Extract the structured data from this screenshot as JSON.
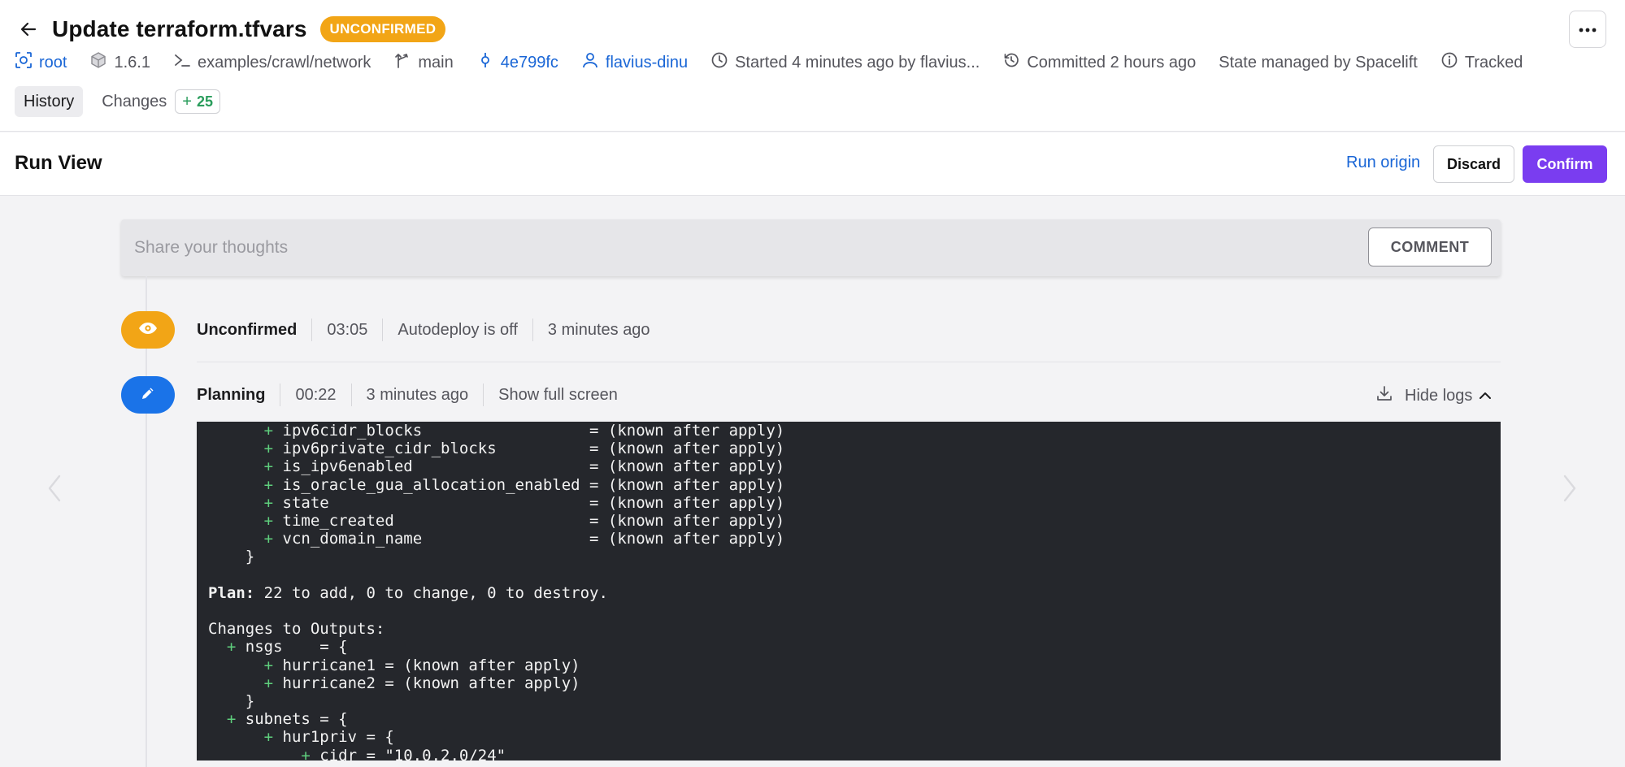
{
  "header": {
    "title": "Update terraform.tfvars",
    "status_badge": "UNCONFIRMED",
    "meta": {
      "space": "root",
      "version": "1.6.1",
      "project_root": "examples/crawl/network",
      "branch": "main",
      "commit": "4e799fc",
      "author": "flavius-dinu",
      "started": "Started 4 minutes ago by flavius...",
      "committed": "Committed 2 hours ago",
      "state": "State managed by Spacelift",
      "tracked": "Tracked"
    },
    "tabs": [
      {
        "label": "History",
        "active": true
      },
      {
        "label": "Changes",
        "count": "25"
      }
    ]
  },
  "run_view": {
    "title": "Run View",
    "run_origin": "Run origin",
    "discard": "Discard",
    "confirm": "Confirm"
  },
  "comment": {
    "placeholder": "Share your thoughts",
    "button": "COMMENT"
  },
  "stages": [
    {
      "name": "Unconfirmed",
      "duration": "03:05",
      "info": "Autodeploy is off",
      "time": "3 minutes ago"
    },
    {
      "name": "Planning",
      "duration": "00:22",
      "time": "3 minutes ago",
      "full_screen": "Show full screen",
      "hide_logs": "Hide logs"
    }
  ],
  "log": {
    "lines": [
      {
        "indent": "      ",
        "plus": true,
        "text": "ipv6cidr_blocks                  = (known after apply)"
      },
      {
        "indent": "      ",
        "plus": true,
        "text": "ipv6private_cidr_blocks          = (known after apply)"
      },
      {
        "indent": "      ",
        "plus": true,
        "text": "is_ipv6enabled                   = (known after apply)"
      },
      {
        "indent": "      ",
        "plus": true,
        "text": "is_oracle_gua_allocation_enabled = (known after apply)"
      },
      {
        "indent": "      ",
        "plus": true,
        "text": "state                            = (known after apply)"
      },
      {
        "indent": "      ",
        "plus": true,
        "text": "time_created                     = (known after apply)"
      },
      {
        "indent": "      ",
        "plus": true,
        "text": "vcn_domain_name                  = (known after apply)"
      },
      {
        "indent": "    ",
        "plus": false,
        "text": "}"
      },
      {
        "indent": "",
        "plus": false,
        "text": ""
      },
      {
        "indent": "",
        "plus": false,
        "bold": "Plan:",
        "text": " 22 to add, 0 to change, 0 to destroy."
      },
      {
        "indent": "",
        "plus": false,
        "text": ""
      },
      {
        "indent": "",
        "plus": false,
        "text": "Changes to Outputs:"
      },
      {
        "indent": "  ",
        "plus": true,
        "text": "nsgs    = {"
      },
      {
        "indent": "      ",
        "plus": true,
        "text": "hurricane1 = (known after apply)"
      },
      {
        "indent": "      ",
        "plus": true,
        "text": "hurricane2 = (known after apply)"
      },
      {
        "indent": "    ",
        "plus": false,
        "text": "}"
      },
      {
        "indent": "  ",
        "plus": true,
        "text": "subnets = {"
      },
      {
        "indent": "      ",
        "plus": true,
        "text": "hur1priv = {"
      },
      {
        "indent": "          ",
        "plus": true,
        "text": "cidr = \"10.0.2.0/24\""
      }
    ]
  },
  "colors": {
    "accent_purple": "#7a3df0",
    "link_blue": "#1a66d6",
    "badge_orange": "#f2a516",
    "planning_blue": "#1a73e8",
    "log_bg": "#25272c",
    "plus_green": "#5fcf7d"
  },
  "icons": {
    "back": "arrow-left-icon",
    "more": "more-horizontal-icon",
    "space": "space-icon",
    "version": "cube-icon",
    "project_root": "terminal-icon",
    "branch": "branch-icon",
    "commit": "commit-icon",
    "author": "user-icon",
    "started": "clock-icon",
    "committed": "history-icon",
    "tracked": "info-icon",
    "unconfirmed": "eye-icon",
    "planning": "pencil-icon",
    "download": "download-icon",
    "hide": "chevron-up-icon"
  }
}
